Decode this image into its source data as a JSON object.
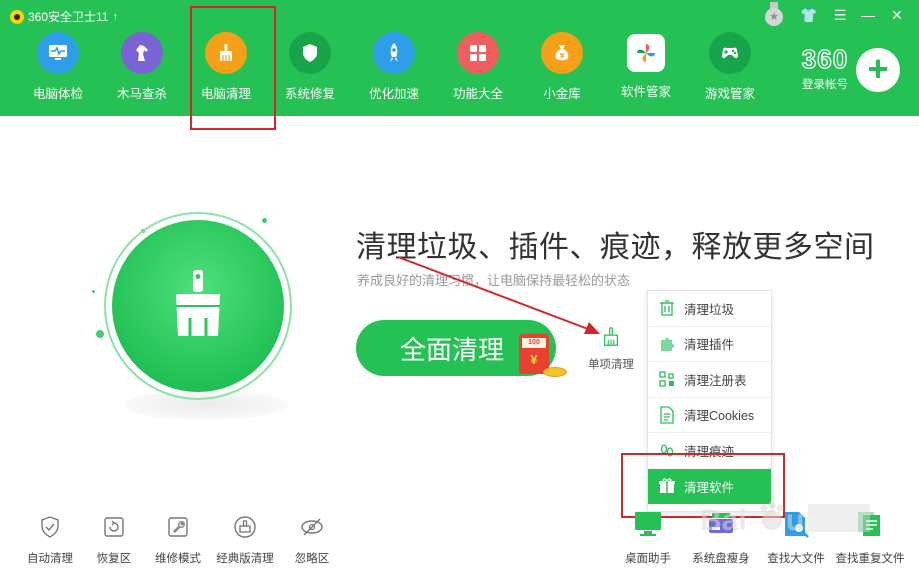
{
  "app": {
    "title": "360安全卫士11",
    "update_arrow": "↑"
  },
  "window_controls": [
    {
      "name": "skin-icon",
      "glyph": "👕"
    },
    {
      "name": "star-icon",
      "glyph": "☆"
    },
    {
      "name": "menu-icon",
      "glyph": "☰"
    },
    {
      "name": "minimize-icon",
      "glyph": "—"
    },
    {
      "name": "close-icon",
      "glyph": "✕"
    }
  ],
  "medal": {
    "glyph": "★"
  },
  "nav": [
    {
      "label": "电脑体检",
      "icon": "monitor-check-icon",
      "color": "#2f9ee8"
    },
    {
      "label": "木马查杀",
      "icon": "horse-icon",
      "color": "#7b63d6"
    },
    {
      "label": "电脑清理",
      "icon": "broom-icon",
      "color": "#f6a01a"
    },
    {
      "label": "系统修复",
      "icon": "shield-icon",
      "color": "#17a44a"
    },
    {
      "label": "优化加速",
      "icon": "rocket-icon",
      "color": "#2f9ee8"
    },
    {
      "label": "功能大全",
      "icon": "grid-icon",
      "color": "#f05f5f"
    },
    {
      "label": "小金库",
      "icon": "money-bag-icon",
      "color": "#f6a01a"
    },
    {
      "label": "软件管家",
      "icon": "pinwheel-icon",
      "color": "#ffffff"
    },
    {
      "label": "游戏管家",
      "icon": "gamepad-icon",
      "color": "#17a44a"
    }
  ],
  "login": {
    "brand": "360",
    "label": "登录帐号",
    "plus": "+"
  },
  "main": {
    "headline": "清理垃圾、插件、痕迹，释放更多空间",
    "subline": "养成良好的清理习惯，让电脑保持最轻松的状态",
    "clean_button": "全面清理",
    "envelope_tag": "100",
    "envelope_symbol": "¥",
    "single_clean": "单项清理"
  },
  "dropdown": [
    {
      "label": "清理垃圾",
      "icon": "trash-icon",
      "active": false
    },
    {
      "label": "清理插件",
      "icon": "puzzle-icon",
      "active": false
    },
    {
      "label": "清理注册表",
      "icon": "registry-icon",
      "active": false
    },
    {
      "label": "清理Cookies",
      "icon": "document-icon",
      "active": false
    },
    {
      "label": "清理痕迹",
      "icon": "footprint-icon",
      "active": false
    },
    {
      "label": "清理软件",
      "icon": "gift-box-icon",
      "active": true
    }
  ],
  "bottom_left": [
    {
      "label": "自动清理",
      "icon": "shield-check-icon"
    },
    {
      "label": "恢复区",
      "icon": "restore-icon"
    },
    {
      "label": "维修模式",
      "icon": "wrench-icon"
    },
    {
      "label": "经典版清理",
      "icon": "classic-clean-icon"
    },
    {
      "label": "忽略区",
      "icon": "ignore-eye-icon"
    }
  ],
  "bottom_right": [
    {
      "label": "桌面助手",
      "icon": "desktop-helper-icon"
    },
    {
      "label": "系统盘瘦身",
      "icon": "disk-slim-icon"
    },
    {
      "label": "查找大文件",
      "icon": "find-large-file-icon"
    },
    {
      "label": "查找重复文件",
      "icon": "find-duplicate-icon"
    }
  ],
  "colors": {
    "brand_green": "#25c154",
    "highlight_red": "#d3262c"
  }
}
